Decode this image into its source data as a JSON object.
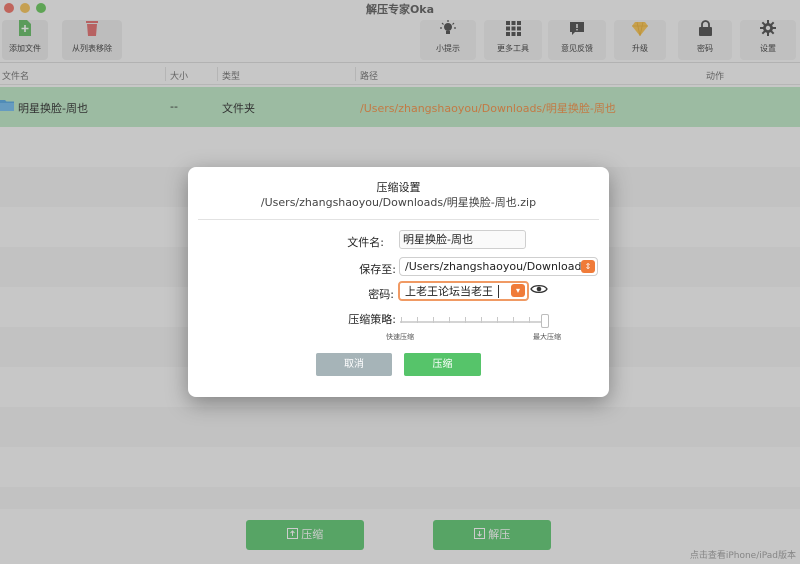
{
  "window": {
    "title": "解压专家Oka"
  },
  "toolbar": {
    "add_file": "添加文件",
    "remove_from_list": "从列表移除",
    "tips": "小提示",
    "more_tools": "更多工具",
    "feedback": "意见反馈",
    "upgrade": "升级",
    "password": "密码",
    "settings": "设置"
  },
  "list": {
    "columns": {
      "name": "文件名",
      "size": "大小",
      "type": "类型",
      "path": "路径",
      "action": "动作"
    },
    "rows": [
      {
        "name": "明星换脸-周也",
        "size": "--",
        "type": "文件夹",
        "path": "/Users/zhangshaoyou/Downloads/明星换脸-周也"
      }
    ]
  },
  "bottom": {
    "compress": "压缩",
    "extract": "解压",
    "footnote": "点击查看iPhone/iPad版本"
  },
  "dialog": {
    "title": "压缩设置",
    "subtitle": "/Users/zhangshaoyou/Downloads/明星换脸-周也.zip",
    "filename_label": "文件名:",
    "filename_value": "明星换脸-周也",
    "saveto_label": "保存至:",
    "saveto_value": "/Users/zhangshaoyou/Downloads",
    "password_label": "密码:",
    "password_value": "上老王论坛当老王",
    "strategy_label": "压缩策略:",
    "strategy_min": "快速压缩",
    "strategy_max": "最大压缩",
    "strategy_level": 1.0,
    "cancel": "取消",
    "compress": "压缩"
  },
  "colors": {
    "accent_green": "#56c46a",
    "accent_orange": "#f07b39",
    "selected_row": "#b9e6c2",
    "cancel_gray": "#a6b4b8"
  },
  "icons": {
    "add_file": "add-file-icon",
    "remove": "trash-icon",
    "tips": "lightbulb-icon",
    "more_tools": "grid-icon",
    "feedback": "chat-icon",
    "upgrade": "diamond-icon",
    "password": "lock-icon",
    "settings": "gear-icon",
    "folder": "folder-icon",
    "eye": "eye-icon"
  }
}
